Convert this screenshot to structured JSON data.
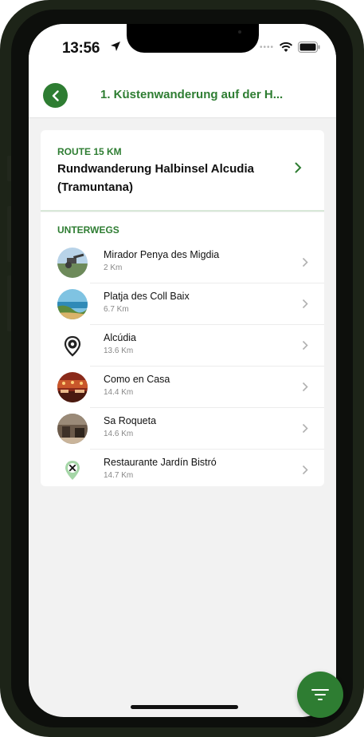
{
  "status_bar": {
    "time": "13:56"
  },
  "header": {
    "title": "1. Küstenwanderung auf der H..."
  },
  "route": {
    "label": "ROUTE 15 KM",
    "name": "Rundwanderung Halbinsel Alcudia (Tramuntana)"
  },
  "stops": {
    "label": "UNTERWEGS",
    "items": [
      {
        "name": "Mirador Penya des Migdia",
        "distance": "2 Km",
        "thumb": "photo-viewpoint"
      },
      {
        "name": "Platja des Coll Baix",
        "distance": "6.7 Km",
        "thumb": "photo-beach"
      },
      {
        "name": "Alcúdia",
        "distance": "13.6 Km",
        "thumb": "location-pin-icon"
      },
      {
        "name": "Como en Casa",
        "distance": "14.4 Km",
        "thumb": "photo-restaurant"
      },
      {
        "name": "Sa Roqueta",
        "distance": "14.6 Km",
        "thumb": "photo-interior"
      },
      {
        "name": "Restaurante Jardín Bistró",
        "distance": "14.7 Km",
        "thumb": "restaurant-pin-icon"
      }
    ]
  },
  "colors": {
    "accent": "#2e7d32",
    "background": "#f2f2f2"
  },
  "fab": {
    "icon": "filter-icon"
  }
}
